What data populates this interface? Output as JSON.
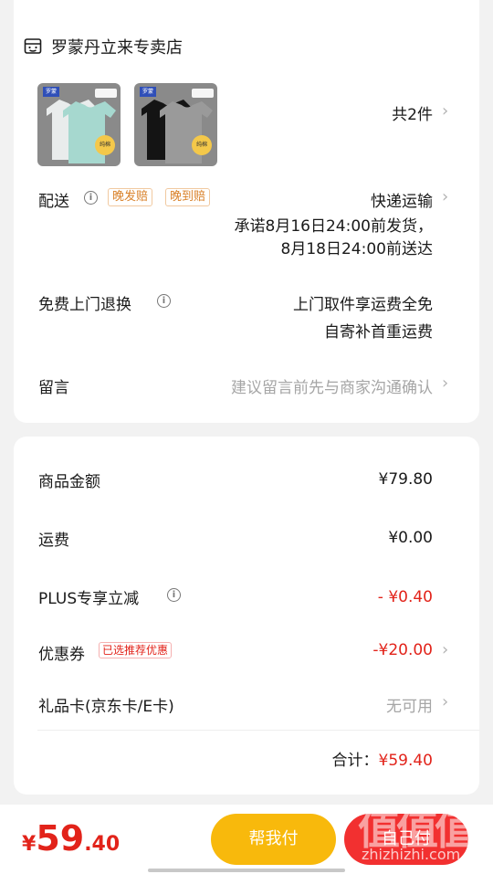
{
  "shop": {
    "name": "罗蒙丹立来专卖店",
    "item_count": "共2件",
    "product_thumbs": [
      {
        "brand": "罗蒙",
        "tag": "纯棉",
        "shirts": [
          "#e9ecec",
          "#a6d8cf"
        ]
      },
      {
        "brand": "罗蒙",
        "tag": "纯棉",
        "shirts": [
          "#141414",
          "#9a9a9a"
        ]
      }
    ]
  },
  "delivery": {
    "label": "配送",
    "badges": [
      "晚发赔",
      "晚到赔"
    ],
    "method": "快递运输",
    "line1": "承诺8月16日24:00前发货，",
    "line2": "8月18日24:00前送达"
  },
  "returns": {
    "label": "免费上门退换",
    "line1": "上门取件享运费全免",
    "line2": "自寄补首重运费"
  },
  "message": {
    "label": "留言",
    "placeholder": "建议留言前先与商家沟通确认"
  },
  "pricing": {
    "goods_label": "商品金额",
    "goods_value": "¥79.80",
    "shipping_label": "运费",
    "shipping_value": "¥0.00",
    "plus_label": "PLUS专享立减",
    "plus_value": "- ¥0.40",
    "coupon_label": "优惠券",
    "coupon_badge": "已选推荐优惠",
    "coupon_value": "-¥20.00",
    "giftcard_label": "礼品卡(京东卡/E卡)",
    "giftcard_value": "无可用",
    "total_label": "合计：",
    "total_value": "¥59.40"
  },
  "bottom": {
    "price_symbol": "¥",
    "price_int": "59",
    "price_dec": ".40",
    "help_pay_label": "帮我付",
    "self_pay_label": "自己付"
  },
  "watermark": {
    "big": "值值值",
    "small": "zhizhizhi.com"
  },
  "icons": {
    "chevron": "chevron-right-icon",
    "info": "info-icon",
    "shop": "shop-icon"
  },
  "colors": {
    "accent_red": "#e2231a",
    "help_button": "#f8b90c",
    "self_button": "#f23030",
    "badge_orange": "#d9822b"
  }
}
